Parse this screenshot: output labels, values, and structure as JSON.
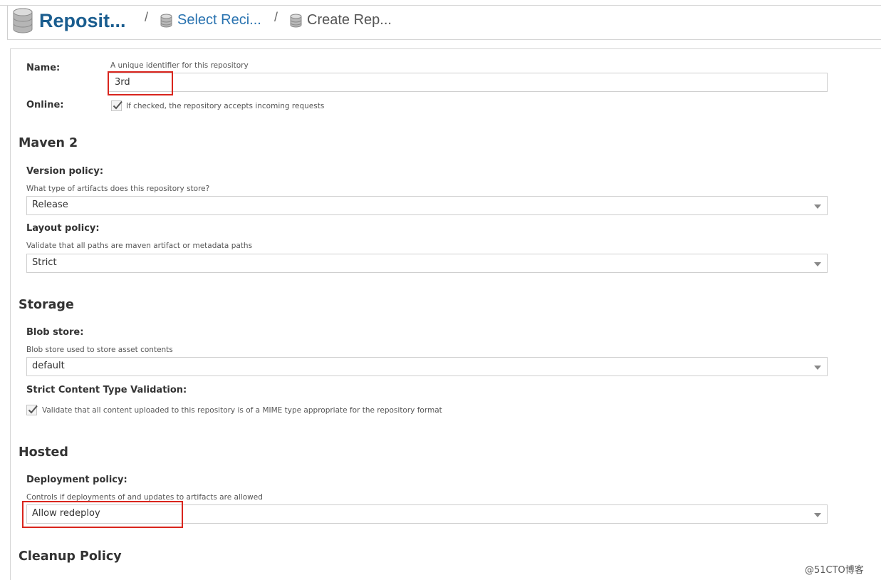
{
  "breadcrumb": {
    "root_label": "Reposit...",
    "separator": "/",
    "step2_label": "Select Reci...",
    "step3_label": "Create Rep..."
  },
  "general": {
    "name_label": "Name:",
    "name_help": "A unique identifier for this repository",
    "name_value": "3rd",
    "online_label": "Online:",
    "online_help": "If checked, the repository accepts incoming requests",
    "online_checked": true
  },
  "maven": {
    "title": "Maven 2",
    "version_label": "Version policy:",
    "version_help": "What type of artifacts does this repository store?",
    "version_value": "Release",
    "layout_label": "Layout policy:",
    "layout_help": "Validate that all paths are maven artifact or metadata paths",
    "layout_value": "Strict"
  },
  "storage": {
    "title": "Storage",
    "blob_label": "Blob store:",
    "blob_help": "Blob store used to store asset contents",
    "blob_value": "default",
    "strict_label": "Strict Content Type Validation:",
    "strict_help": "Validate that all content uploaded to this repository is of a MIME type appropriate for the repository format",
    "strict_checked": true
  },
  "hosted": {
    "title": "Hosted",
    "deploy_label": "Deployment policy:",
    "deploy_help": "Controls if deployments of and updates to artifacts are allowed",
    "deploy_value": "Allow redeploy"
  },
  "cleanup": {
    "title": "Cleanup Policy"
  },
  "watermark": "@51CTO博客",
  "colors": {
    "brand": "#1a5d8f",
    "link": "#2a73b0",
    "highlight": "#d9251d"
  },
  "icons": {
    "breadcrumb": "database-icon",
    "checkbox": "checkmark-icon",
    "select": "chevron-down-icon"
  }
}
